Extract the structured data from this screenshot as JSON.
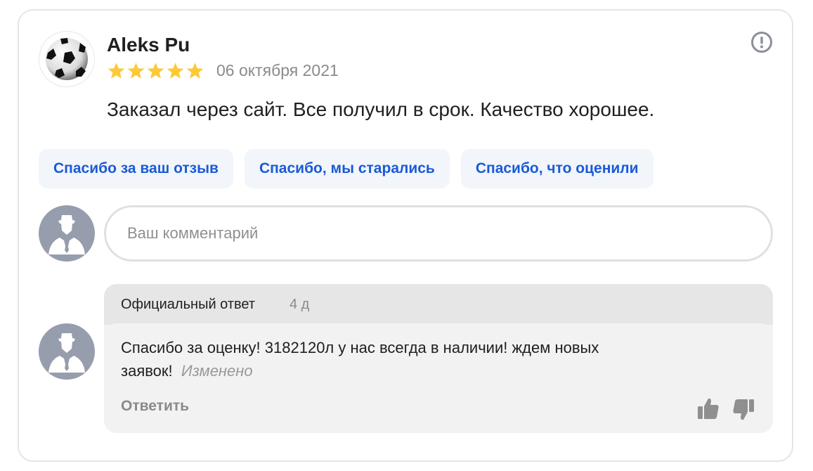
{
  "review": {
    "author": "Aleks Pu",
    "rating": 5,
    "date": "06 октября 2021",
    "text": "Заказал через сайт. Все получил в срок. Качество хорошее.",
    "avatar_icon": "soccer-ball-icon",
    "report_icon": "exclamation-circle-icon"
  },
  "quick_replies": [
    "Спасибо за ваш отзыв",
    "Спасибо, мы старались",
    "Спасибо, что оценили"
  ],
  "comment": {
    "placeholder": "Ваш комментарий",
    "value": ""
  },
  "official_reply": {
    "title": "Официальный ответ",
    "age": "4 д",
    "text": "Спасибо за оценку! 3182120л у нас всегда в наличии! ждем новых заявок!",
    "edited": "Изменено",
    "reply_label": "Ответить",
    "like_icon": "thumbs-up-icon",
    "dislike_icon": "thumbs-down-icon"
  },
  "colors": {
    "star": "#fcc937",
    "link": "#1a5ad7",
    "chip_bg": "#f2f5fa",
    "muted": "#8a8a8a",
    "avatar_bg": "#969dad"
  }
}
